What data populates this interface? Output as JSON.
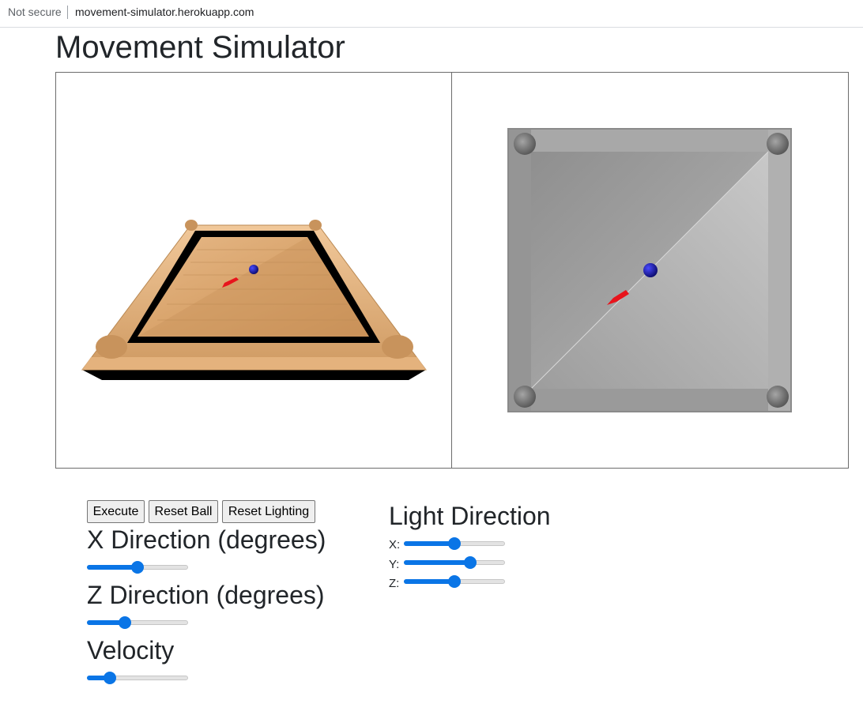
{
  "browser": {
    "security_label": "Not secure",
    "url": "movement-simulator.herokuapp.com"
  },
  "page": {
    "title": "Movement Simulator"
  },
  "controls": {
    "execute_label": "Execute",
    "reset_ball_label": "Reset Ball",
    "reset_lighting_label": "Reset Lighting",
    "x_direction": {
      "label": "X Direction (degrees)",
      "value_fraction": 0.5
    },
    "z_direction": {
      "label": "Z Direction (degrees)",
      "value_fraction": 0.36
    },
    "velocity": {
      "label": "Velocity",
      "value_fraction": 0.19
    }
  },
  "light_direction": {
    "heading": "Light Direction",
    "x": {
      "label": "X:",
      "value_fraction": 0.5
    },
    "y": {
      "label": "Y:",
      "value_fraction": 0.68
    },
    "z": {
      "label": "Z:",
      "value_fraction": 0.5
    }
  },
  "colors": {
    "accent": "#0a75e6",
    "ball": "#1a1aa8",
    "arrow": "#e8141c",
    "wood": "#d9a46c",
    "metal": "#9a9a9a"
  }
}
